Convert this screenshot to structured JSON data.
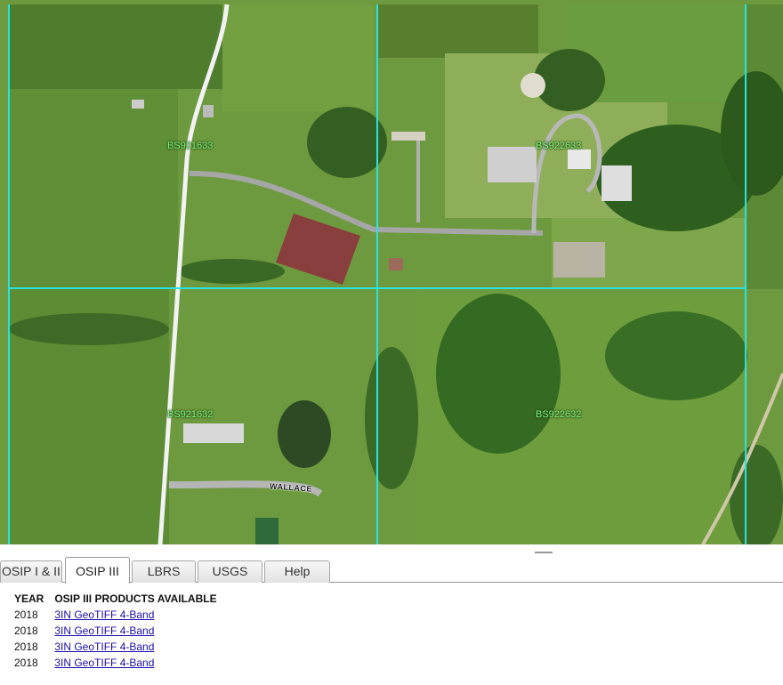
{
  "map": {
    "tile_labels": {
      "nw": "BS921633",
      "ne": "BS922633",
      "sw": "BS921632",
      "se": "BS922632"
    },
    "road_label": "WALLACE",
    "colors": {
      "grid_line": "#27e3e0",
      "tile_label": "#7cf07c"
    }
  },
  "tabs": [
    {
      "label": "OSIP I & II",
      "active": false
    },
    {
      "label": "OSIP III",
      "active": true
    },
    {
      "label": "LBRS",
      "active": false
    },
    {
      "label": "USGS",
      "active": false
    },
    {
      "label": "Help",
      "active": false
    }
  ],
  "products": {
    "headers": {
      "year": "YEAR",
      "products": "OSIP III PRODUCTS AVAILABLE"
    },
    "rows": [
      {
        "year": "2018",
        "product": "3IN GeoTIFF 4-Band"
      },
      {
        "year": "2018",
        "product": "3IN GeoTIFF 4-Band"
      },
      {
        "year": "2018",
        "product": "3IN GeoTIFF 4-Band"
      },
      {
        "year": "2018",
        "product": "3IN GeoTIFF 4-Band"
      }
    ]
  }
}
